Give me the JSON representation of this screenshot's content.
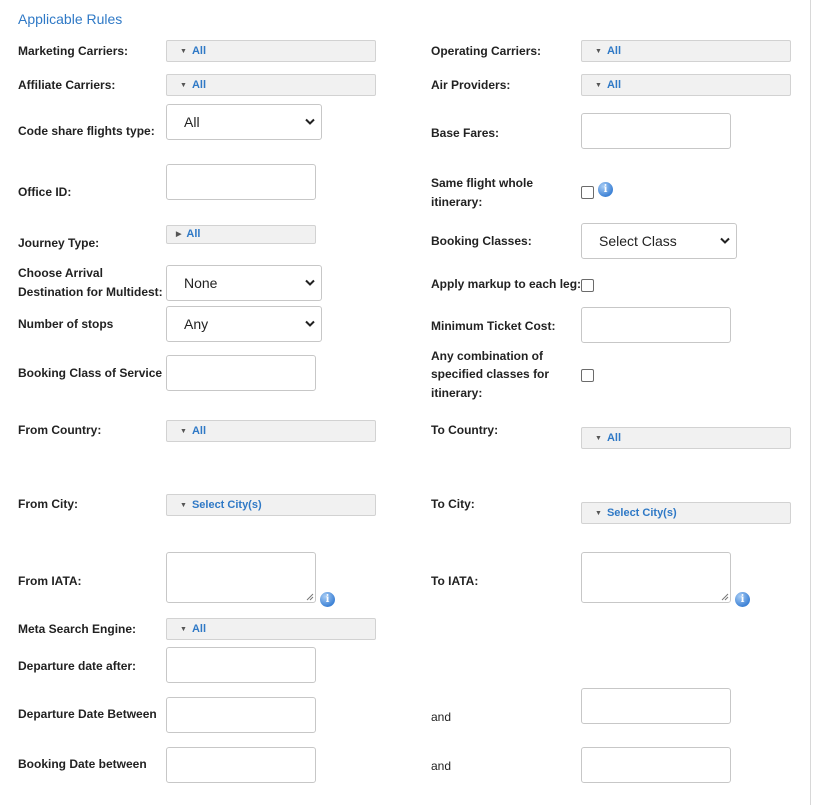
{
  "section": {
    "title": "Applicable Rules"
  },
  "labels": {
    "marketing_carriers": "Marketing Carriers:",
    "operating_carriers": "Operating Carriers:",
    "affiliate_carriers": "Affiliate Carriers:",
    "air_providers": "Air Providers:",
    "code_share_type": "Code share flights type:",
    "base_fares": "Base Fares:",
    "office_id": "Office ID:",
    "same_flight_line1": "Same flight whole",
    "same_flight_line2": "itinerary:",
    "journey_type": "Journey Type:",
    "booking_classes": "Booking Classes:",
    "arrival_line1": "Choose Arrival",
    "arrival_line2": "Destination for Multidest:",
    "apply_markup": "Apply markup to each leg:",
    "number_of_stops": "Number of stops",
    "min_ticket_cost": "Minimum Ticket Cost:",
    "booking_class_service": "Booking Class of Service",
    "any_combo_line1": "Any combination of",
    "any_combo_line2": "specified classes for",
    "any_combo_line3": "itinerary:",
    "from_country": "From Country:",
    "to_country": "To Country:",
    "from_city": "From City:",
    "to_city": "To City:",
    "from_iata": "From IATA:",
    "to_iata": "To IATA:",
    "meta_search": "Meta Search Engine:",
    "departure_after": "Departure date after:",
    "departure_between": "Departure Date Between",
    "booking_between": "Booking Date between",
    "and_1": "and",
    "and_2": "and"
  },
  "multiselects": {
    "marketing_carriers": "All",
    "operating_carriers": "All",
    "affiliate_carriers": "All",
    "air_providers": "All",
    "journey_type": "All",
    "from_country": "All",
    "to_country": "All",
    "from_city": "Select City(s)",
    "to_city": "Select City(s)",
    "meta_search": "All"
  },
  "selects": {
    "code_share_type": "All",
    "booking_classes": "Select Class",
    "arrival_destination": "None",
    "number_of_stops": "Any"
  },
  "checkboxes": {
    "same_flight_whole_itinerary": false,
    "apply_markup_each_leg": false,
    "any_combination_classes": false
  },
  "icons": {
    "info": "info-icon",
    "info_glyph": "i",
    "caret_down": "▼",
    "caret_right": "▶"
  },
  "colors": {
    "accent": "#2f79c6",
    "multiselect_bg": "#f1f1f1",
    "border": "#c7c7c7"
  }
}
